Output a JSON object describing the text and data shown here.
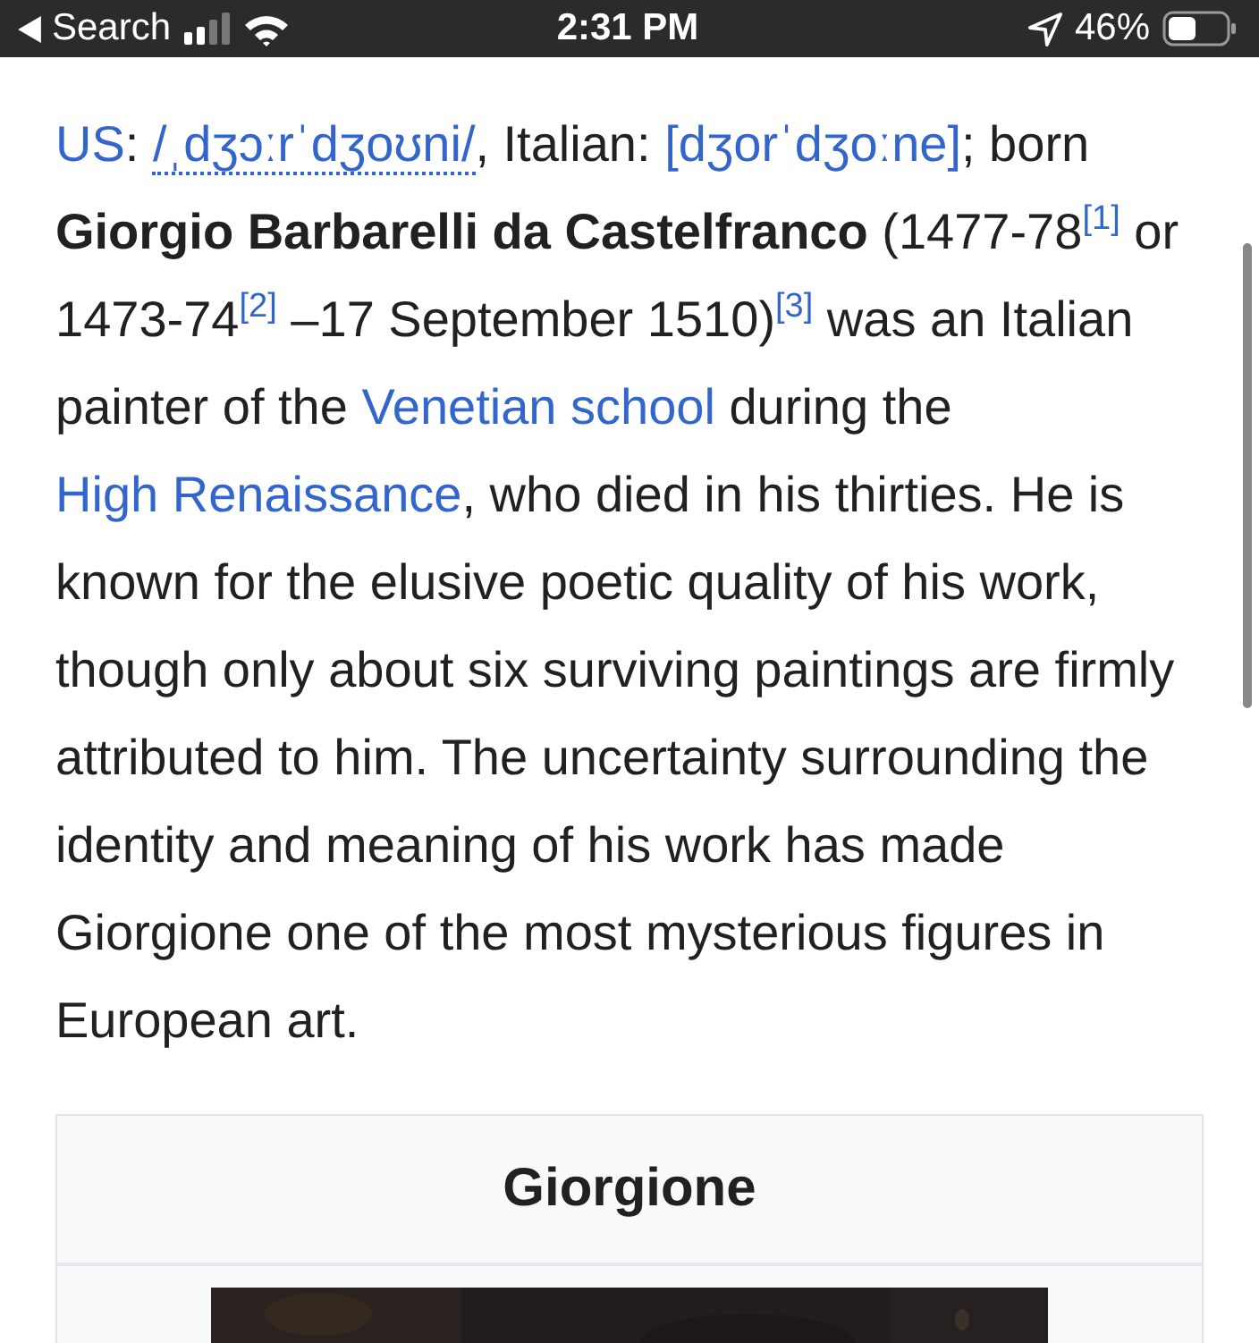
{
  "status_bar": {
    "back_label": "Search",
    "time": "2:31 PM",
    "battery": "46%"
  },
  "paragraph": [
    {
      "kind": "link",
      "text": "US"
    },
    {
      "kind": "text",
      "text": ": "
    },
    {
      "kind": "ipa",
      "text": "/ˌdʒɔːrˈdʒoʊni/"
    },
    {
      "kind": "text",
      "text": ", Italian: "
    },
    {
      "kind": "link",
      "text": "[dʒorˈdʒoːne]"
    },
    {
      "kind": "text",
      "text": "; born "
    },
    {
      "kind": "bold",
      "text": "Giorgio Barbarelli da Castelfranco"
    },
    {
      "kind": "text",
      "text": " (1477-78"
    },
    {
      "kind": "ref",
      "text": "[1]"
    },
    {
      "kind": "text",
      "text": " or 1473-74"
    },
    {
      "kind": "ref",
      "text": "[2]"
    },
    {
      "kind": "text",
      "text": " –17 September 1510)"
    },
    {
      "kind": "ref",
      "text": "[3]"
    },
    {
      "kind": "text",
      "text": " was an Italian painter of the "
    },
    {
      "kind": "link",
      "text": "Venetian school"
    },
    {
      "kind": "text",
      "text": " during the "
    },
    {
      "kind": "link",
      "text": "High Renaissance"
    },
    {
      "kind": "text",
      "text": ", who died in his thirties. He is known for the elusive poetic quality of his work, though only about six surviving paintings are firmly attributed to him. The uncertainty surrounding the identity and meaning of his work has made Giorgione one of the most mysterious figures in European art."
    }
  ],
  "infobox": {
    "title": "Giorgione"
  }
}
